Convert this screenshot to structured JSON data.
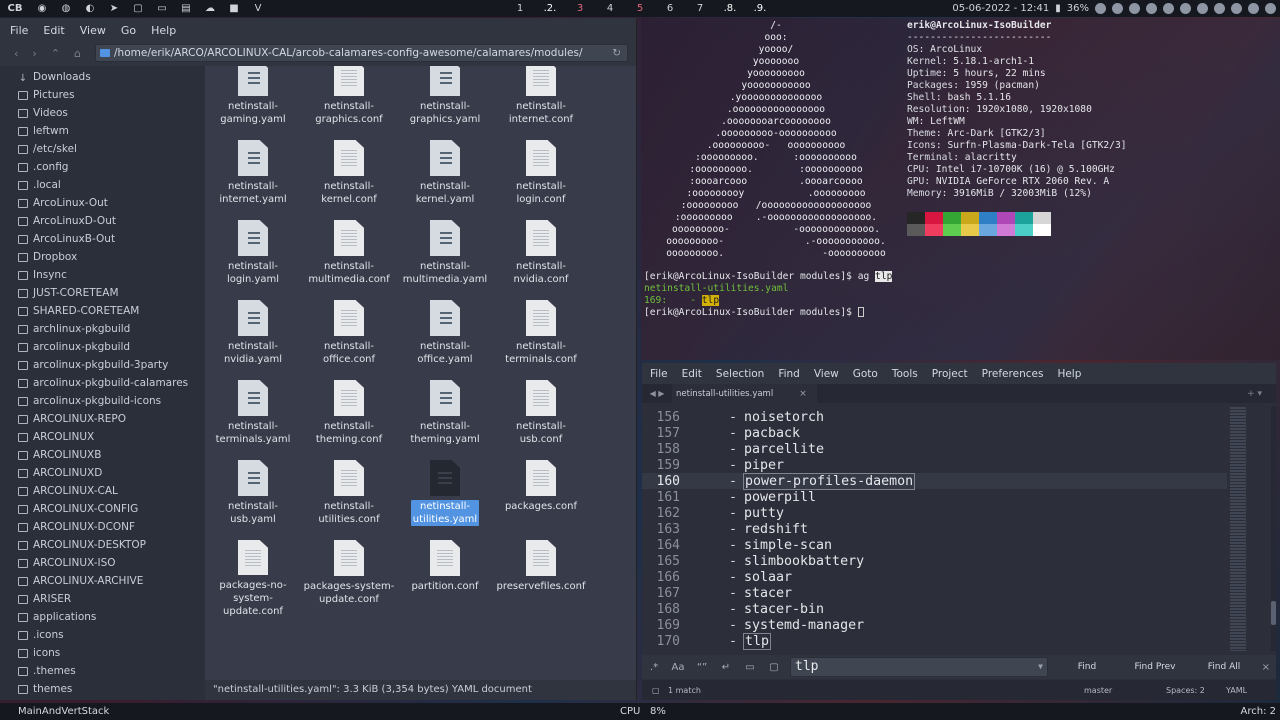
{
  "topbar": {
    "launcher": "CB",
    "tags": [
      "1",
      ".2.",
      "3",
      "4",
      "5",
      "6",
      "7",
      ".8.",
      ".9."
    ],
    "datetime": "05-06-2022 - 12:41",
    "battery": "36%"
  },
  "file_manager": {
    "menu": [
      "File",
      "Edit",
      "View",
      "Go",
      "Help"
    ],
    "path": "/home/erik/ARCO/ARCOLINUX-CAL/arcob-calamares-config-awesome/calamares/modules/",
    "sidebar": [
      "Downloads",
      "Pictures",
      "Videos",
      "leftwm",
      "/etc/skel",
      ".config",
      ".local",
      "ArcoLinux-Out",
      "ArcoLinuxD-Out",
      "ArcoLinuxB-Out",
      "Dropbox",
      "Insync",
      "JUST-CORETEAM",
      "SHARED-CORETEAM",
      "archlinux-pkgbuild",
      "arcolinux-pkgbuild",
      "arcolinux-pkgbuild-3party",
      "arcolinux-pkgbuild-calamares",
      "arcolinux-pkgbuild-icons",
      "ARCOLINUX-REPO",
      "ARCOLINUX",
      "ARCOLINUXB",
      "ARCOLINUXD",
      "ARCOLINUX-CAL",
      "ARCOLINUX-CONFIG",
      "ARCOLINUX-DCONF",
      "ARCOLINUX-DESKTOP",
      "ARCOLINUX-ISO",
      "ARCOLINUX-ARCHIVE",
      "ARISER",
      "applications",
      ".icons",
      "icons",
      ".themes",
      "themes"
    ],
    "files": [
      {
        "l1": "netinstall-",
        "l2": "gaming.yaml",
        "t": "yaml"
      },
      {
        "l1": "netinstall-",
        "l2": "graphics.conf",
        "t": "conf"
      },
      {
        "l1": "netinstall-",
        "l2": "graphics.yaml",
        "t": "yaml"
      },
      {
        "l1": "netinstall-",
        "l2": "internet.conf",
        "t": "conf"
      },
      {
        "l1": "netinstall-",
        "l2": "internet.yaml",
        "t": "yaml"
      },
      {
        "l1": "netinstall-",
        "l2": "kernel.conf",
        "t": "conf"
      },
      {
        "l1": "netinstall-",
        "l2": "kernel.yaml",
        "t": "yaml"
      },
      {
        "l1": "netinstall-",
        "l2": "login.conf",
        "t": "conf"
      },
      {
        "l1": "netinstall-",
        "l2": "login.yaml",
        "t": "yaml"
      },
      {
        "l1": "netinstall-",
        "l2": "multimedia.conf",
        "t": "conf"
      },
      {
        "l1": "netinstall-",
        "l2": "multimedia.yaml",
        "t": "yaml"
      },
      {
        "l1": "netinstall-",
        "l2": "nvidia.conf",
        "t": "conf"
      },
      {
        "l1": "netinstall-",
        "l2": "nvidia.yaml",
        "t": "yaml"
      },
      {
        "l1": "netinstall-",
        "l2": "office.conf",
        "t": "conf"
      },
      {
        "l1": "netinstall-",
        "l2": "office.yaml",
        "t": "yaml"
      },
      {
        "l1": "netinstall-",
        "l2": "terminals.conf",
        "t": "conf"
      },
      {
        "l1": "netinstall-",
        "l2": "terminals.yaml",
        "t": "yaml"
      },
      {
        "l1": "netinstall-",
        "l2": "theming.conf",
        "t": "conf"
      },
      {
        "l1": "netinstall-",
        "l2": "theming.yaml",
        "t": "yaml"
      },
      {
        "l1": "netinstall-usb.conf",
        "l2": "",
        "t": "conf"
      },
      {
        "l1": "netinstall-usb.yaml",
        "l2": "",
        "t": "yaml"
      },
      {
        "l1": "netinstall-",
        "l2": "utilities.conf",
        "t": "conf"
      },
      {
        "l1": "netinstall-",
        "l2": "utilities.yaml",
        "t": "dark",
        "selected": true
      },
      {
        "l1": "packages.conf",
        "l2": "",
        "t": "conf"
      },
      {
        "l1": "packages-no-",
        "l2": "system-",
        "l3": "update.conf",
        "t": "conf"
      },
      {
        "l1": "packages-system-",
        "l2": "update.conf",
        "t": "conf"
      },
      {
        "l1": "partition.conf",
        "l2": "",
        "t": "conf"
      },
      {
        "l1": "preservefiles.conf",
        "l2": "",
        "t": "conf"
      }
    ],
    "status": "\"netinstall-utilities.yaml\": 3.3 KiB (3,354 bytes) YAML document"
  },
  "terminal": {
    "ascii": [
      "/-",
      "ooo:",
      "yoooo/",
      "yooooooo",
      "yooooooooo",
      "yooooooooooo",
      ".yoooooooooooooo",
      ".oooooooooooooooo",
      ".oooooooarcoooooooo",
      ".ooooooooo-oooooooooo",
      ".ooooooooo-   oooooooooo",
      ":ooooooooo.      :oooooooooo",
      ":ooooooooo.        :oooooooooo",
      ":oooarcooo         .oooarcoooo",
      ":ooooooooy           .ooooooooo",
      ":ooooooooo   /ooooooooooooooooooo",
      ":ooooooooo    .-oooooooooooooooooo.",
      "ooooooooo-           -ooooooooooooo.",
      "ooooooooo-              .-ooooooooooo.",
      "ooooooooo.                 -oooooooooo"
    ],
    "header": "erik@ArcoLinux-IsoBuilder",
    "separator": "-------------------------",
    "info": [
      {
        "k": "OS",
        "v": "ArcoLinux"
      },
      {
        "k": "Kernel",
        "v": "5.18.1-arch1-1"
      },
      {
        "k": "Uptime",
        "v": "5 hours, 22 mins"
      },
      {
        "k": "Packages",
        "v": "1959 (pacman)"
      },
      {
        "k": "Shell",
        "v": "bash 5.1.16"
      },
      {
        "k": "Resolution",
        "v": "1920x1080, 1920x1080"
      },
      {
        "k": "WM",
        "v": "LeftWM"
      },
      {
        "k": "Theme",
        "v": "Arc-Dark [GTK2/3]"
      },
      {
        "k": "Icons",
        "v": "Surfn-Plasma-Dark-Tela [GTK2/3]"
      },
      {
        "k": "Terminal",
        "v": "alacritty"
      },
      {
        "k": "CPU",
        "v": "Intel i7-10700K (16) @ 5.100GHz"
      },
      {
        "k": "GPU",
        "v": "NVIDIA GeForce RTX 2060 Rev. A"
      },
      {
        "k": "Memory",
        "v": "3916MiB / 32003MiB (12%)"
      }
    ],
    "swatch_row1": [
      "#262626",
      "#d9163f",
      "#33a633",
      "#c9a91b",
      "#2f7fc7",
      "#b047b6",
      "#1ca39b",
      "#d6d6d6"
    ],
    "swatch_row2": [
      "#5a5a5a",
      "#f03c5e",
      "#5ecc4f",
      "#e8c94a",
      "#6aa7de",
      "#d07ad6",
      "#4ccfc6",
      "#ffffff"
    ],
    "prompt1": "[erik@ArcoLinux-IsoBuilder modules]$ ag ",
    "query": "tlp",
    "result_file": "netinstall-utilities.yaml",
    "result_line": "169:    - ",
    "prompt2": "[erik@ArcoLinux-IsoBuilder modules]$ "
  },
  "editor": {
    "menu": [
      "File",
      "Edit",
      "Selection",
      "Find",
      "View",
      "Goto",
      "Tools",
      "Project",
      "Preferences",
      "Help"
    ],
    "tab": "netinstall-utilities.yaml",
    "lines": [
      {
        "n": "156",
        "t": "noisetorch"
      },
      {
        "n": "157",
        "t": "pacback"
      },
      {
        "n": "158",
        "t": "parcellite"
      },
      {
        "n": "159",
        "t": "piper"
      },
      {
        "n": "160",
        "t": "power-profiles-daemon",
        "cur": true,
        "box": true
      },
      {
        "n": "161",
        "t": "powerpill"
      },
      {
        "n": "162",
        "t": "putty"
      },
      {
        "n": "163",
        "t": "redshift"
      },
      {
        "n": "164",
        "t": "simple-scan"
      },
      {
        "n": "165",
        "t": "slimbookbattery"
      },
      {
        "n": "166",
        "t": "solaar"
      },
      {
        "n": "167",
        "t": "stacer"
      },
      {
        "n": "168",
        "t": "stacer-bin"
      },
      {
        "n": "169",
        "t": "systemd-manager"
      },
      {
        "n": "170",
        "t": "tlp",
        "box": true
      }
    ],
    "find": {
      "value": "tlp",
      "find": "Find",
      "find_prev": "Find Prev",
      "find_all": "Find All"
    },
    "status": {
      "matches": "1 match",
      "branch": "master",
      "spaces": "Spaces: 2",
      "syntax": "YAML"
    }
  },
  "bottombar": {
    "layout": "MainAndVertStack",
    "cpu_label": "CPU",
    "cpu_value": "8%",
    "arch": "Arch: 2"
  }
}
